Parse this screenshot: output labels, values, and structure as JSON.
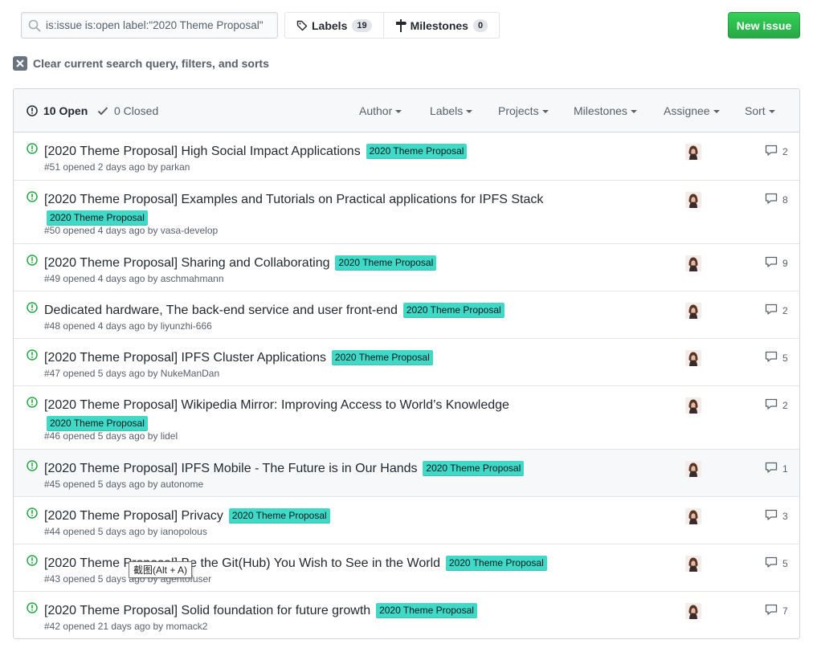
{
  "search": {
    "value": "is:issue is:open label:\"2020 Theme Proposal\""
  },
  "nav": {
    "labels": {
      "label": "Labels",
      "count": "19"
    },
    "milestones": {
      "label": "Milestones",
      "count": "0"
    }
  },
  "new_issue_label": "New issue",
  "clear_label": "Clear current search query, filters, and sorts",
  "header": {
    "open": "10 Open",
    "closed": "0 Closed",
    "filters": [
      "Author",
      "Labels",
      "Projects",
      "Milestones",
      "Assignee",
      "Sort"
    ]
  },
  "label_color": "#40d9c8",
  "issues": [
    {
      "title": "[2020 Theme Proposal] High Social Impact Applications",
      "label": "2020 Theme Proposal",
      "meta": "#51 opened 2 days ago by parkan",
      "comments": "2"
    },
    {
      "title": "[2020 Theme Proposal] Examples and Tutorials on Practical applications for IPFS Stack",
      "label": "2020 Theme Proposal",
      "meta": "#50 opened 4 days ago by vasa-develop",
      "comments": "8"
    },
    {
      "title": "[2020 Theme Proposal] Sharing and Collaborating",
      "label": "2020 Theme Proposal",
      "meta": "#49 opened 4 days ago by aschmahmann",
      "comments": "9"
    },
    {
      "title": "Dedicated hardware, The back-end service and user front-end",
      "label": "2020 Theme Proposal",
      "meta": "#48 opened 4 days ago by liyunzhi-666",
      "comments": "2"
    },
    {
      "title": "[2020 Theme Proposal] IPFS Cluster Applications",
      "label": "2020 Theme Proposal",
      "meta": "#47 opened 5 days ago by NukeManDan",
      "comments": "5"
    },
    {
      "title": "[2020 Theme Proposal] Wikipedia Mirror: Improving Access to World’s Knowledge",
      "label": "2020 Theme Proposal",
      "meta": "#46 opened 5 days ago by lidel",
      "comments": "2"
    },
    {
      "title": "[2020 Theme Proposal] IPFS Mobile - The Future is in Our Hands",
      "label": "2020 Theme Proposal",
      "meta": "#45 opened 5 days ago by autonome",
      "comments": "1"
    },
    {
      "title": "[2020 Theme Proposal] Privacy",
      "label": "2020 Theme Proposal",
      "meta": "#44 opened 5 days ago by ianopolous",
      "comments": "3"
    },
    {
      "title": "[2020 Theme Proposal] Be the Git(Hub) You Wish to See in the World",
      "label": "2020 Theme Proposal",
      "meta": "#43 opened 5 days ago by agentofuser",
      "comments": "5"
    },
    {
      "title": "[2020 Theme Proposal] Solid foundation for future growth",
      "label": "2020 Theme Proposal",
      "meta": "#42 opened 21 days ago by momack2",
      "comments": "7"
    }
  ],
  "tooltip": "截图(Alt + A)"
}
